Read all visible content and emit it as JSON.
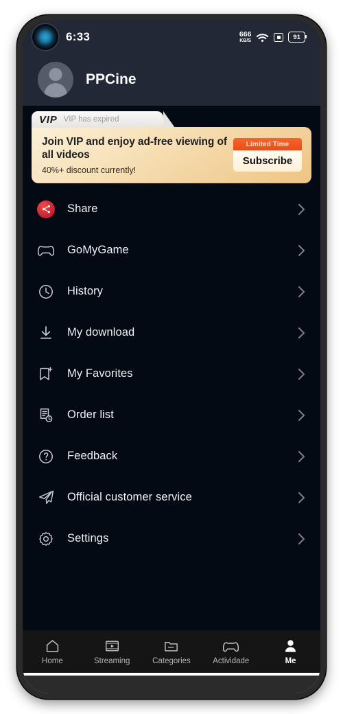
{
  "status_bar": {
    "time": "6:33",
    "net_speed_value": "666",
    "net_speed_unit": "KB/S",
    "battery_percent": "91",
    "icons": [
      "camera-punch-hole",
      "wifi-icon",
      "nfc-icon",
      "battery-icon"
    ]
  },
  "profile": {
    "username": "PPCine",
    "avatar_icon": "default-user-avatar"
  },
  "vip_banner": {
    "logo": "VIP",
    "status": "VIP has expired",
    "headline": "Join VIP and enjoy ad-free viewing of all videos",
    "subtext": "40%+ discount currently!",
    "badge_label": "Limited Time",
    "button_label": "Subscribe",
    "colors": {
      "banner_start": "#fbf0d8",
      "banner_end": "#eec482",
      "badge": "#ef4a19",
      "button": "#fffdf4"
    }
  },
  "menu": {
    "items": [
      {
        "label": "Share",
        "icon": "share-icon",
        "highlight": "#c0192b"
      },
      {
        "label": "GoMyGame",
        "icon": "gamepad-icon",
        "highlight": ""
      },
      {
        "label": "History",
        "icon": "clock-icon",
        "highlight": ""
      },
      {
        "label": "My download",
        "icon": "download-icon",
        "highlight": ""
      },
      {
        "label": "My Favorites",
        "icon": "bookmark-plus-icon",
        "highlight": ""
      },
      {
        "label": "Order list",
        "icon": "order-document-icon",
        "highlight": ""
      },
      {
        "label": "Feedback",
        "icon": "question-circle-icon",
        "highlight": ""
      },
      {
        "label": "Official customer service",
        "icon": "paper-plane-icon",
        "highlight": ""
      },
      {
        "label": "Settings",
        "icon": "gear-icon",
        "highlight": ""
      }
    ],
    "chevron_icon": "chevron-right-icon"
  },
  "bottom_nav": {
    "items": [
      {
        "label": "Home",
        "icon": "home-icon",
        "active": false
      },
      {
        "label": "Streaming",
        "icon": "video-icon",
        "active": false
      },
      {
        "label": "Categories",
        "icon": "folder-icon",
        "active": false
      },
      {
        "label": "Actividade",
        "icon": "gamepad-icon",
        "active": false
      },
      {
        "label": "Me",
        "icon": "person-icon",
        "active": true
      }
    ]
  },
  "system": {
    "gesture_bar": "home-gesture-bar"
  }
}
